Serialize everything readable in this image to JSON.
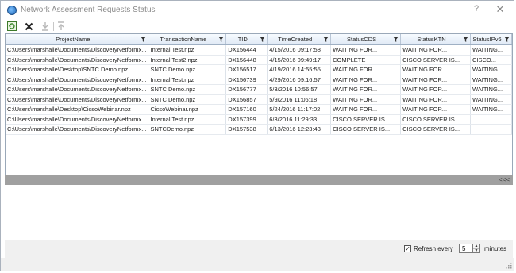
{
  "window": {
    "title": "Network Assessment Requests Status",
    "help_label": "?",
    "close_label": "✕"
  },
  "toolbar": {
    "buttons": [
      {
        "name": "refresh-icon",
        "enabled": true
      },
      {
        "name": "delete-icon",
        "enabled": true
      },
      {
        "name": "download-icon",
        "enabled": false
      },
      {
        "name": "upload-icon",
        "enabled": false
      }
    ]
  },
  "grid": {
    "columns": [
      "ProjectName",
      "TransactionName",
      "TID",
      "TimeCreated",
      "StatusCDS",
      "StatusKTN",
      "StatusIPv6"
    ],
    "rows": [
      [
        "C:\\Users\\marshalle\\Documents\\DiscoveryNetformx...",
        "Internal Test.npz",
        "DX156444",
        "4/15/2016 09:17:58",
        "WAITING FOR...",
        "WAITING FOR...",
        "WAITING..."
      ],
      [
        "C:\\Users\\marshalle\\Documents\\DiscoveryNetformx...",
        "Internal Test2.npz",
        "DX156448",
        "4/15/2016 09:49:17",
        "COMPLETE",
        "CISCO SERVER IS...",
        "CISCO..."
      ],
      [
        "C:\\Users\\marshalle\\Desktop\\SNTC Demo.npz",
        "SNTC Demo.npz",
        "DX156517",
        "4/19/2016 14:55:55",
        "WAITING FOR...",
        "WAITING FOR...",
        "WAITING..."
      ],
      [
        "C:\\Users\\marshalle\\Documents\\DiscoveryNetformx...",
        "Internal Test.npz",
        "DX156739",
        "4/29/2016 09:16:57",
        "WAITING FOR...",
        "WAITING FOR...",
        "WAITING..."
      ],
      [
        "C:\\Users\\marshalle\\Documents\\DiscoveryNetformx...",
        "SNTC Demo.npz",
        "DX156777",
        "5/3/2016 10:56:57",
        "WAITING FOR...",
        "WAITING FOR...",
        "WAITING..."
      ],
      [
        "C:\\Users\\marshalle\\Documents\\DiscoveryNetformx...",
        "SNTC Demo.npz",
        "DX156857",
        "5/9/2016 11:06:18",
        "WAITING FOR...",
        "WAITING FOR...",
        "WAITING..."
      ],
      [
        "C:\\Users\\marshalle\\Desktop\\CicsoWebinar.npz",
        "CicsoWebinar.npz",
        "DX157160",
        "5/24/2016 11:17:02",
        "WAITING FOR...",
        "WAITING FOR...",
        "WAITING..."
      ],
      [
        "C:\\Users\\marshalle\\Documents\\DiscoveryNetformx...",
        "Internal Test.npz",
        "DX157399",
        "6/3/2016 11:29:33",
        "CISCO SERVER IS...",
        "CISCO SERVER IS...",
        ""
      ],
      [
        "C:\\Users\\marshalle\\Documents\\DiscoveryNetformx...",
        "SNTCDemo.npz",
        "DX157538",
        "6/13/2016 12:23:43",
        "CISCO SERVER IS...",
        "CISCO SERVER IS...",
        ""
      ]
    ]
  },
  "divider": {
    "expand_label": "<<<"
  },
  "footer": {
    "refresh_checked": true,
    "refresh_label": "Refresh every",
    "interval_value": "5",
    "minutes_label": "minutes"
  }
}
